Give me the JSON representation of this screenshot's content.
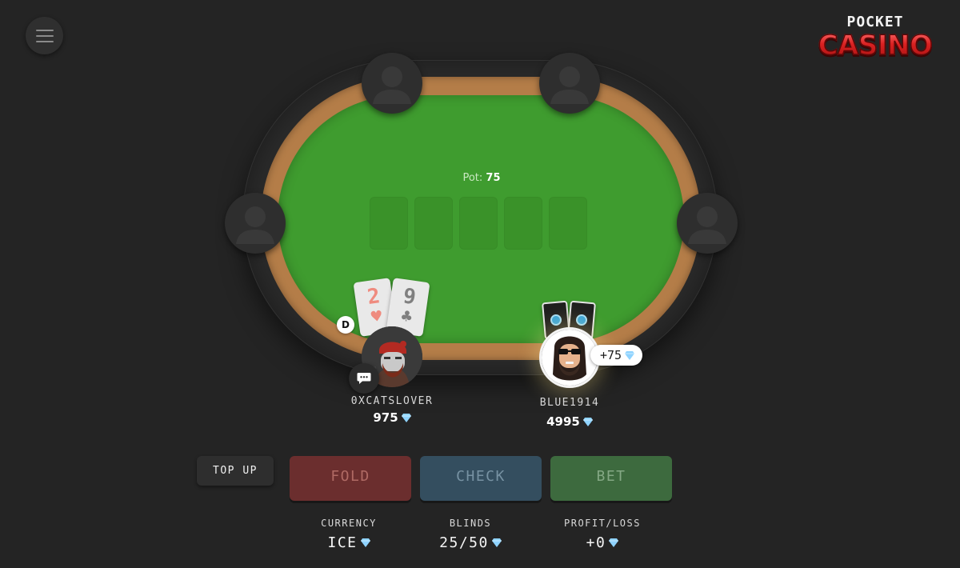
{
  "logo": {
    "top": "POCKET",
    "main": "CASINO"
  },
  "pot": {
    "label": "Pot:",
    "value": "75"
  },
  "players": [
    {
      "name": "0XCATSLOVER",
      "chips": "975",
      "cards": [
        {
          "rank": "2",
          "suit": "♥",
          "color": "red"
        },
        {
          "rank": "9",
          "suit": "♣",
          "color": "black"
        }
      ],
      "dealer_label": "D"
    },
    {
      "name": "BLUE1914",
      "chips": "4995",
      "win_badge": "+75"
    }
  ],
  "actions": {
    "top_up": "TOP UP",
    "fold": "FOLD",
    "check": "CHECK",
    "bet": "BET"
  },
  "stats": {
    "currency": {
      "label": "CURRENCY",
      "value": "ICE"
    },
    "blinds": {
      "label": "BLINDS",
      "value": "25/50"
    },
    "profit": {
      "label": "PROFIT/LOSS",
      "value": "+0"
    }
  },
  "icons": {
    "menu": "hamburger-icon",
    "seat": "empty-seat-avatar-icon",
    "currency": "diamond-icon",
    "chat": "chat-bubble-icon"
  },
  "colors": {
    "background": "#242424",
    "felt": "#3f9c2f",
    "rail": "#b47d48",
    "fold": "#6b2e2e",
    "check": "#344e5f",
    "bet": "#3d6a3e",
    "gem": "#8fd3ff"
  }
}
